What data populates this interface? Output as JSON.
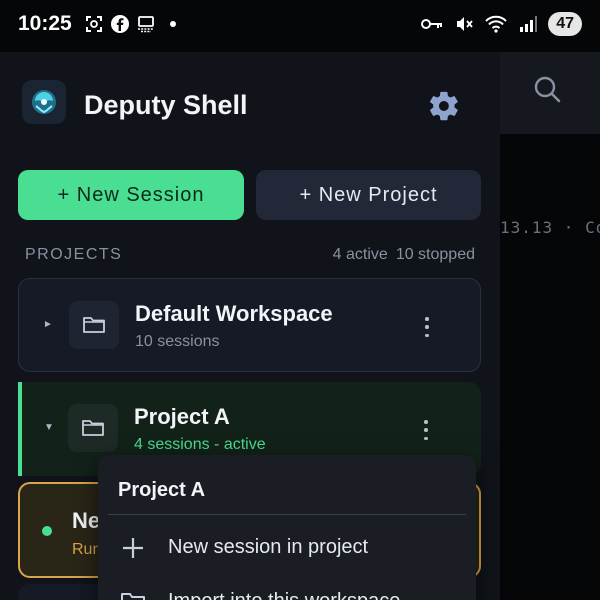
{
  "status_bar": {
    "time": "10:25",
    "battery": "47",
    "left_icons": [
      "screenshot-icon",
      "facebook-icon",
      "desktop-icon",
      "notification-dot"
    ],
    "right_icons": [
      "key-icon",
      "mute-icon",
      "wifi-icon",
      "signal-icon"
    ]
  },
  "background_app": {
    "search_icon": "search-icon",
    "meta_text": "13.13 · Co"
  },
  "drawer": {
    "app_title": "Deputy Shell",
    "logo_icon": "app-logo-icon",
    "settings_icon": "gear-icon",
    "new_session_label": "+ New Session",
    "new_project_label": "+ New Project",
    "section_label": "PROJECTS",
    "active_count": "4 active",
    "stopped_count": "10 stopped",
    "projects": [
      {
        "name": "Default Workspace",
        "sub": "10 sessions",
        "expanded": false
      },
      {
        "name": "Project A",
        "sub": "4 sessions - active",
        "expanded": true
      }
    ],
    "session": {
      "name": "Ne",
      "status": "Run"
    }
  },
  "popup_menu": {
    "title": "Project A",
    "items": [
      {
        "label": "New session in project",
        "icon": "plus-icon"
      },
      {
        "label": "Import into this workspace",
        "icon": "import-folder-icon"
      }
    ]
  },
  "colors": {
    "accent": "#4ade93",
    "warning": "#d9a54a",
    "drawer_bg": "#101319"
  }
}
